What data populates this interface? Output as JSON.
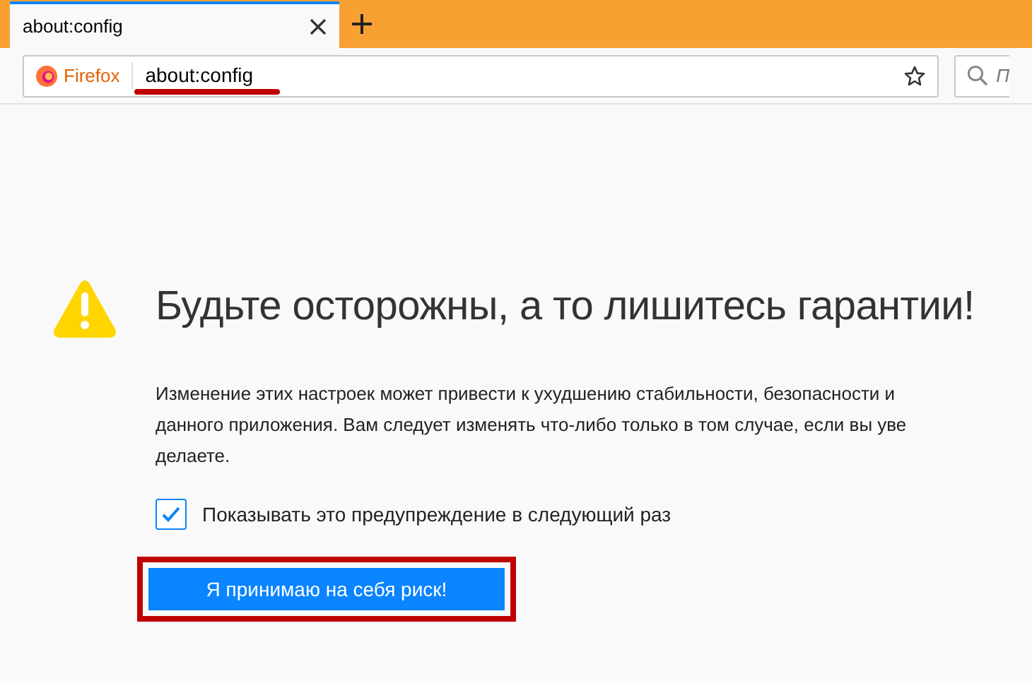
{
  "tab": {
    "title": "about:config",
    "selected": true
  },
  "address_bar": {
    "brand": "Firefox",
    "url": "about:config"
  },
  "search": {
    "placeholder": "П"
  },
  "warning": {
    "title": "Будьте осторожны, а то лишитесь гарантии!",
    "lines": [
      "Изменение этих настроек может привести к ухудшению стабильности, безопасности и",
      "данного приложения. Вам следует изменять что-либо только в том случае, если вы уве",
      "делаете."
    ],
    "checkbox": {
      "label": "Показывать это предупреждение в следующий раз",
      "checked": true
    },
    "button": "Я принимаю на себя риск!"
  }
}
